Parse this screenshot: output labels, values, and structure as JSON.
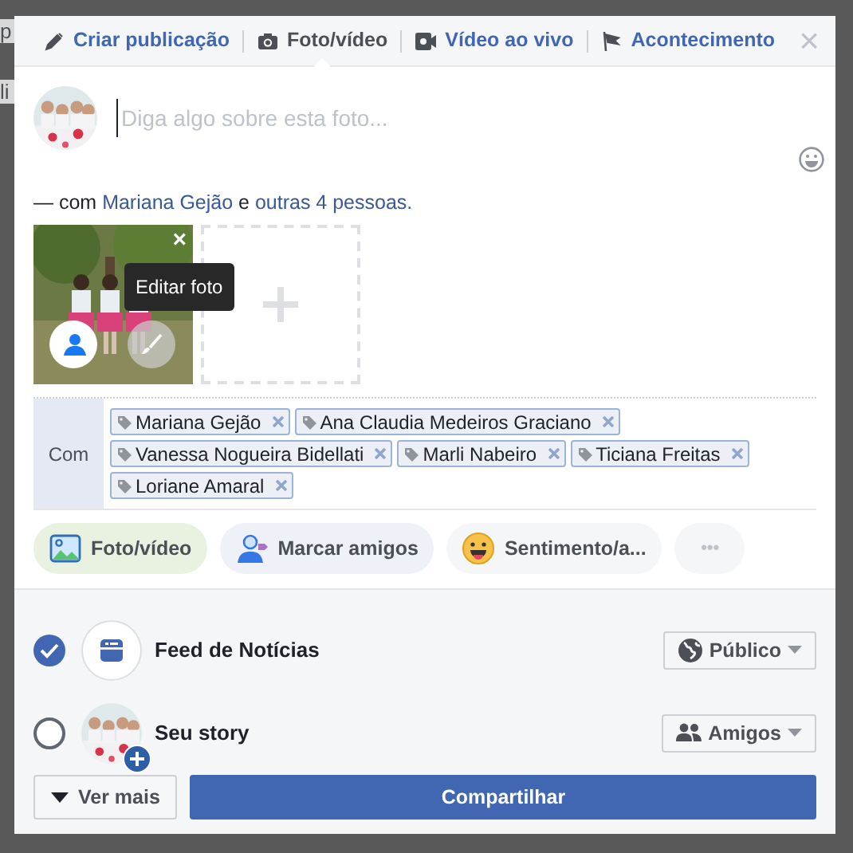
{
  "background_fragments": [
    "p",
    "li"
  ],
  "tabs": [
    {
      "label": "Criar publicação",
      "kind": "post",
      "selected": false
    },
    {
      "label": "Foto/vídeo",
      "selected": true
    },
    {
      "label": "Vídeo ao vivo",
      "kind": "live",
      "selected": false
    },
    {
      "label": "Acontecimento",
      "kind": "event",
      "selected": false
    }
  ],
  "close": "×",
  "composer": {
    "placeholder": "Diga algo sobre esta foto..."
  },
  "with_line": [
    {
      "kind": "text",
      "text": "— com "
    },
    {
      "kind": "link",
      "text": "Mariana Gejão"
    },
    {
      "kind": "text",
      "text": " e "
    },
    {
      "kind": "link",
      "text": "outras 4 pessoas."
    }
  ],
  "photo": {
    "remove": "×",
    "tooltip": "Editar foto"
  },
  "tags": {
    "label": "Com",
    "items": [
      {
        "name": "Mariana Gejão"
      },
      {
        "name": "Ana Claudia Medeiros Graciano"
      },
      {
        "name": "Vanessa Nogueira Bidellati"
      },
      {
        "name": "Marli Nabeiro"
      },
      {
        "name": "Ticiana Freitas"
      },
      {
        "name": "Loriane Amaral"
      }
    ]
  },
  "actions": [
    {
      "label": "Foto/vídeo"
    },
    {
      "kind": "tag",
      "label": "Marcar amigos"
    },
    {
      "kind": "feeling",
      "label": "Sentimento/a..."
    },
    {
      "kind": "more",
      "label": "•••"
    }
  ],
  "audiences": [
    {
      "kind": "feed",
      "label": "Feed de Notícias",
      "selected": true,
      "privacy": "Público"
    },
    {
      "kind": "story",
      "label": "Seu story",
      "selected": false,
      "privacy": "Amigos"
    }
  ],
  "footer": {
    "more": "Ver mais",
    "submit": "Compartilhar"
  }
}
